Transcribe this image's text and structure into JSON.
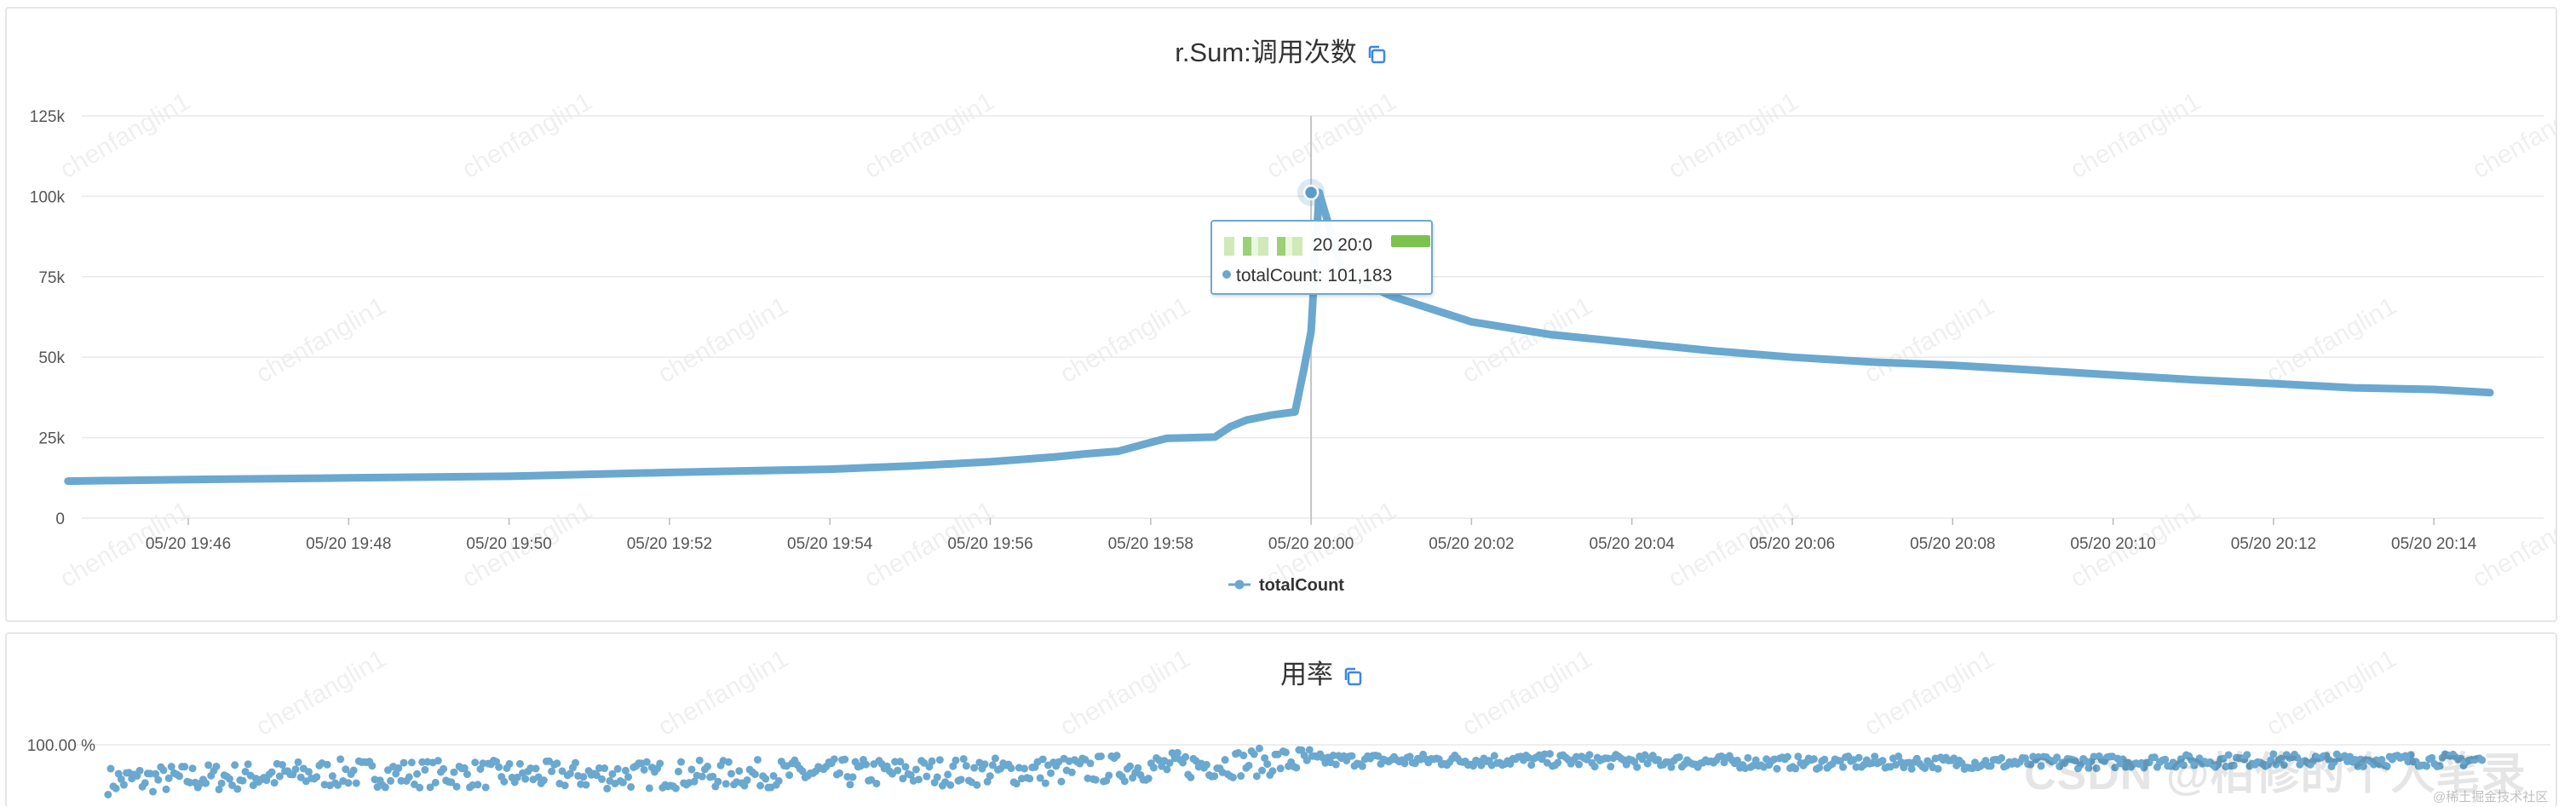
{
  "panels": [
    {
      "title": "r.Sum:调用次数",
      "legend": "totalCount",
      "tooltip": {
        "time": "20 20:0",
        "series": "totalCount",
        "value": "101,183"
      }
    },
    {
      "title": "用率",
      "ytick": "100.00 %"
    }
  ],
  "watermark": "chenfanglin1",
  "source_watermark": "CSDN @柏修的个人笔录",
  "source_sub": "@稀土掘金技术社区",
  "colors": {
    "series": "#6aa8cf",
    "grid": "#e9e9e9",
    "crosshair": "#c4c4c4"
  },
  "chart_data": [
    {
      "type": "line",
      "title": "r.Sum:调用次数",
      "xlabel": "",
      "ylabel": "",
      "x_tick_labels": [
        "05/20 19:46",
        "05/20 19:48",
        "05/20 19:50",
        "05/20 19:52",
        "05/20 19:54",
        "05/20 19:56",
        "05/20 19:58",
        "05/20 20:00",
        "05/20 20:02",
        "05/20 20:04",
        "05/20 20:06",
        "05/20 20:08",
        "05/20 20:10",
        "05/20 20:12",
        "05/20 20:14"
      ],
      "y_tick_labels": [
        "0",
        "25k",
        "50k",
        "75k",
        "100k",
        "125k"
      ],
      "ylim": [
        0,
        125000
      ],
      "xlim_minutes": [
        -16,
        15
      ],
      "x_unit": "minutes relative to 05/20 20:00",
      "grid": true,
      "legend_position": "bottom-center",
      "highlight": {
        "x": 0,
        "y": 101183
      },
      "series": [
        {
          "name": "totalCount",
          "x": [
            -15.5,
            -14,
            -12,
            -10,
            -8,
            -6,
            -5,
            -4,
            -3.2,
            -3,
            -2.8,
            -2.4,
            -2,
            -1.8,
            -1.5,
            -1.2,
            -1,
            -0.8,
            -0.5,
            -0.2,
            -0.1,
            0,
            0.1,
            0.4,
            1,
            2,
            3,
            4,
            5,
            6,
            7,
            8,
            9,
            10,
            11,
            12,
            13,
            14,
            14.7
          ],
          "y": [
            11500,
            12000,
            12500,
            13000,
            14200,
            15200,
            16200,
            17500,
            19000,
            19500,
            20000,
            20800,
            23500,
            24800,
            25000,
            25200,
            28500,
            30500,
            32000,
            33000,
            45000,
            58000,
            101183,
            76000,
            69000,
            61000,
            57000,
            54500,
            52000,
            50000,
            48500,
            47500,
            46000,
            44500,
            43000,
            41800,
            40500,
            40000,
            39000
          ]
        }
      ]
    },
    {
      "type": "scatter",
      "title": "用率",
      "y_tick_labels": [
        "100.00 %"
      ],
      "note": "dense noisy series hovering just below 100%, partially visible",
      "series": [
        {
          "name": "",
          "x": [
            -15,
            -12,
            -9,
            -6,
            -3,
            0,
            3,
            6,
            9,
            12,
            14.5
          ],
          "y": [
            98.6,
            98.9,
            98.8,
            98.9,
            99.0,
            99.4,
            99.4,
            99.3,
            99.3,
            99.4,
            99.4
          ]
        }
      ]
    }
  ]
}
